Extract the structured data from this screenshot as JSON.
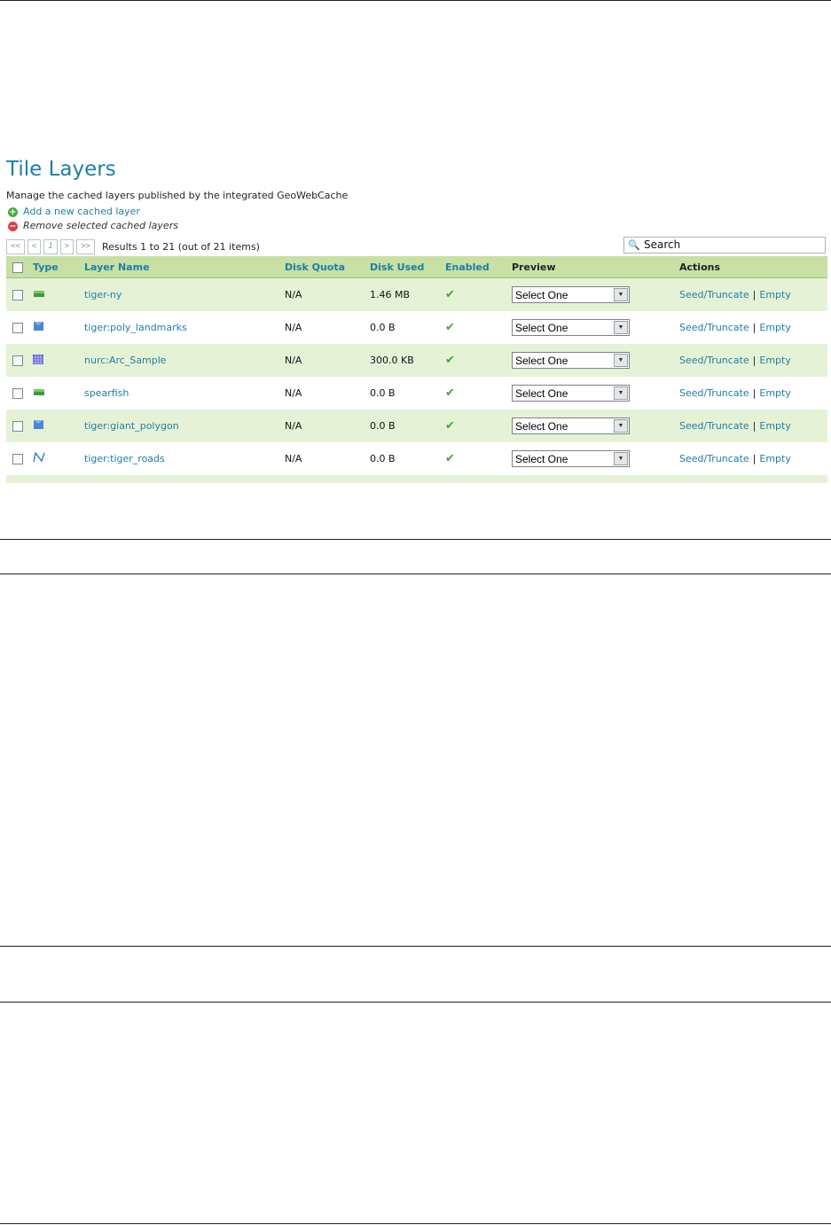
{
  "page": {
    "title": "Tile Layers",
    "description": "Manage the cached layers published by the integrated GeoWebCache",
    "add_link": "Add a new cached layer",
    "remove_link": "Remove selected cached layers"
  },
  "pager": {
    "first": "<<",
    "prev": "<",
    "current": "1",
    "next": ">",
    "last": ">>",
    "results": "Results 1 to 21 (out of 21 items)"
  },
  "search": {
    "placeholder": "Search"
  },
  "columns": {
    "type": "Type",
    "layer_name": "Layer Name",
    "disk_quota": "Disk Quota",
    "disk_used": "Disk Used",
    "enabled": "Enabled",
    "preview": "Preview",
    "actions": "Actions"
  },
  "rows": [
    {
      "type_icon": "raster-layer-icon",
      "name": "tiger-ny",
      "quota": "N/A",
      "used": "1.46 MB",
      "enabled": "✔",
      "preview": "Select One",
      "seed": "Seed/Truncate",
      "sep": "|",
      "empty": "Empty"
    },
    {
      "type_icon": "polygon-layer-icon",
      "name": "tiger:poly_landmarks",
      "quota": "N/A",
      "used": "0.0 B",
      "enabled": "✔",
      "preview": "Select One",
      "seed": "Seed/Truncate",
      "sep": "|",
      "empty": "Empty"
    },
    {
      "type_icon": "grid-raster-icon",
      "name": "nurc:Arc_Sample",
      "quota": "N/A",
      "used": "300.0 KB",
      "enabled": "✔",
      "preview": "Select One",
      "seed": "Seed/Truncate",
      "sep": "|",
      "empty": "Empty"
    },
    {
      "type_icon": "raster-layer-icon",
      "name": "spearfish",
      "quota": "N/A",
      "used": "0.0 B",
      "enabled": "✔",
      "preview": "Select One",
      "seed": "Seed/Truncate",
      "sep": "|",
      "empty": "Empty"
    },
    {
      "type_icon": "polygon-layer-icon",
      "name": "tiger:giant_polygon",
      "quota": "N/A",
      "used": "0.0 B",
      "enabled": "✔",
      "preview": "Select One",
      "seed": "Seed/Truncate",
      "sep": "|",
      "empty": "Empty"
    },
    {
      "type_icon": "line-layer-icon",
      "name": "tiger:tiger_roads",
      "quota": "N/A",
      "used": "0.0 B",
      "enabled": "✔",
      "preview": "Select One",
      "seed": "Seed/Truncate",
      "sep": "|",
      "empty": "Empty"
    }
  ],
  "colors": {
    "accent": "#1e7ea8",
    "header_bg": "#c8e0a4",
    "row_alt_bg": "#e6f2d6",
    "check": "#4f9e3c"
  }
}
